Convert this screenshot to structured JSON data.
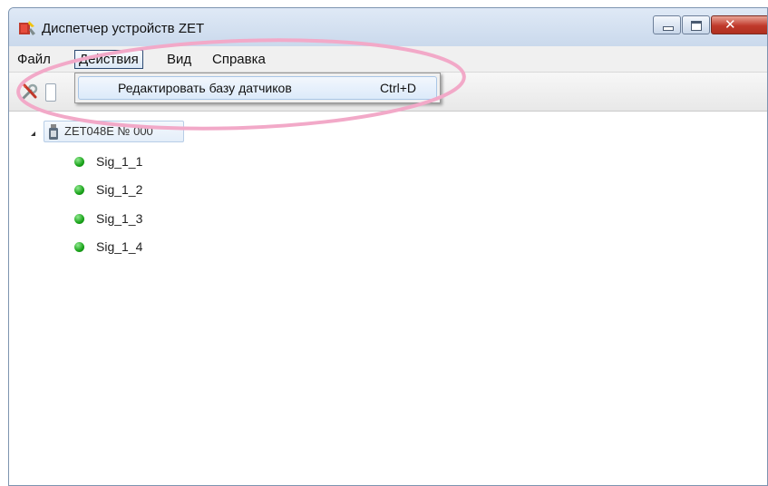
{
  "window": {
    "title": "Диспетчер устройств ZET"
  },
  "menubar": {
    "items": [
      {
        "label": "Файл"
      },
      {
        "label": "Действия"
      },
      {
        "label": "Вид"
      },
      {
        "label": "Справка"
      }
    ]
  },
  "dropdown": {
    "items": [
      {
        "label": "Редактировать базу датчиков",
        "shortcut": "Ctrl+D"
      }
    ]
  },
  "tree": {
    "root": {
      "label": "ZET048E № 000"
    },
    "children": [
      {
        "label": "Sig_1_1"
      },
      {
        "label": "Sig_1_2"
      },
      {
        "label": "Sig_1_3"
      },
      {
        "label": "Sig_1_4"
      }
    ]
  },
  "icons": {
    "app": "zet-app-icon",
    "toolbar": "settings-tools-icon",
    "device": "usb-device-icon",
    "signal": "green-status-dot-icon"
  },
  "colors": {
    "signal_status": "#1aa31a",
    "highlight": "#f2a9c8",
    "close_button": "#c0392b"
  }
}
